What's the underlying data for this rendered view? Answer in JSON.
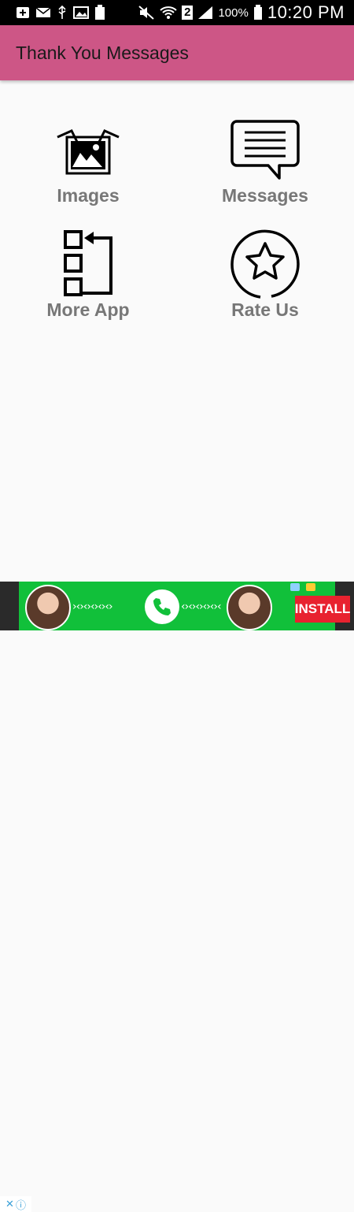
{
  "status_bar": {
    "battery_percent": "100%",
    "time": "10:20 PM",
    "sim_slot": "2"
  },
  "app_bar": {
    "title": "Thank You Messages"
  },
  "menu": {
    "items": [
      {
        "label": "Images",
        "icon": "images-icon"
      },
      {
        "label": "Messages",
        "icon": "message-icon"
      },
      {
        "label": "More App",
        "icon": "more-apps-icon"
      },
      {
        "label": "Rate Us",
        "icon": "star-icon"
      }
    ]
  },
  "ad": {
    "install_label": "INSTALL"
  },
  "colors": {
    "app_bar": "#cd5686",
    "label": "#777777",
    "ad_background": "#11c03a",
    "install_button": "#e8222f"
  }
}
